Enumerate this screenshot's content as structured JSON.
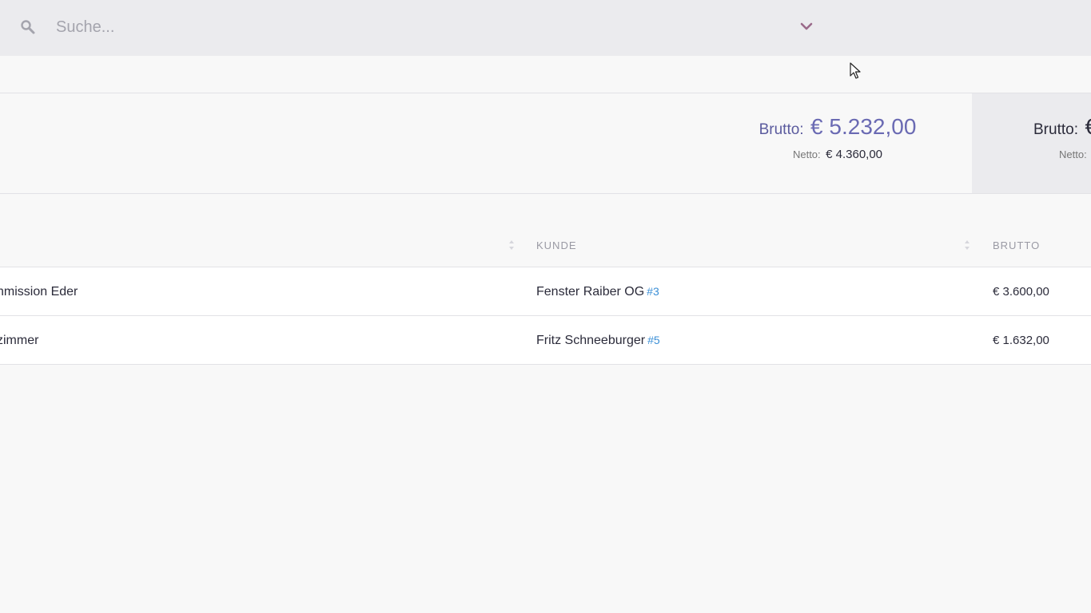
{
  "search": {
    "placeholder": "Suche..."
  },
  "totals": {
    "primary": {
      "brutto_label": "Brutto:",
      "brutto_value": "€ 5.232,00",
      "netto_label": "Netto:",
      "netto_value": "€ 4.360,00"
    },
    "secondary": {
      "brutto_label": "Brutto:",
      "brutto_value": "€",
      "netto_label": "Netto:"
    }
  },
  "table": {
    "columns": {
      "kunde": "KUNDE",
      "brutto": "BRUTTO"
    },
    "rows": [
      {
        "project": "nmission Eder",
        "customer": "Fenster Raiber OG",
        "customer_ref": "#3",
        "brutto": "€ 3.600,00"
      },
      {
        "project": "zimmer",
        "customer": "Fritz Schneeburger",
        "customer_ref": "#5",
        "brutto": "€ 1.632,00"
      }
    ]
  },
  "colors": {
    "accent": "#6a6ab3",
    "link": "#3b8fd6",
    "chevron": "#9a6a8a"
  },
  "icons": {
    "search": "search-icon",
    "chevron": "chevron-down-icon",
    "sort": "sort-icon",
    "cursor": "cursor-icon"
  }
}
